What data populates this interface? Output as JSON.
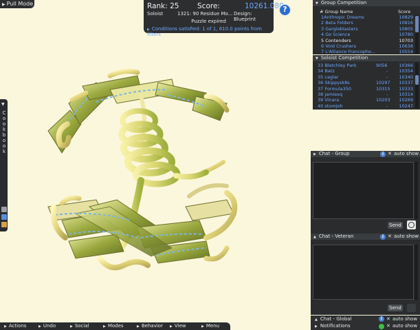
{
  "top_left": {
    "pull_mode_label": "Pull Mode"
  },
  "score_panel": {
    "rank_label": "Rank: 25",
    "score_label": "Score:",
    "score_value": "10261.080",
    "mode": "Soloist",
    "puzzle_desc": "1321: 90 Residue Mo...",
    "design_label": "Design: Blueprint",
    "status": "Puzzle expired",
    "conditions": "Conditions satisfied: 1 of 1, 610.0 points from filters"
  },
  "help_button": {
    "label": "?"
  },
  "group_competition": {
    "title": "Group Competition",
    "col_group": "# Group Name",
    "col_score": "Score",
    "rows": [
      {
        "name": "1Anthropic Dreams",
        "score": "10829",
        "self": false
      },
      {
        "name": "2 Beta Folders",
        "score": "10816",
        "self": false
      },
      {
        "name": "3 Gargleblasters",
        "score": "10805",
        "self": false
      },
      {
        "name": "4 Go Science",
        "score": "10780",
        "self": false
      },
      {
        "name": "5 Contenders",
        "score": "10703",
        "self": true
      },
      {
        "name": "6 Void Crushers",
        "score": "10638",
        "self": false
      },
      {
        "name": "7 L'Alliance Francopho...",
        "score": "10554",
        "self": false
      }
    ]
  },
  "soloist_competition": {
    "title": "Soloist Competition",
    "rows": [
      {
        "name": "33 Bletchley Park",
        "mid": "9056",
        "score": "10366"
      },
      {
        "name": "34 Batz",
        "mid": "-",
        "score": "10354"
      },
      {
        "name": "35 caglar",
        "mid": "-",
        "score": "10340"
      },
      {
        "name": "36 Skippysk8s",
        "mid": "10297",
        "score": "10337"
      },
      {
        "name": "37 Formula350",
        "mid": "10315",
        "score": "10333"
      },
      {
        "name": "38 jamiexq",
        "mid": "-",
        "score": "10314"
      },
      {
        "name": "39 Vinara",
        "mid": "10203",
        "score": "10269"
      },
      {
        "name": "40 stomjoh",
        "mid": "-",
        "score": "10247"
      }
    ]
  },
  "chat_group": {
    "title": "Chat - Group",
    "auto_show": "auto show",
    "send_label": "Send"
  },
  "chat_veteran": {
    "title": "Chat - Veteran",
    "auto_show": "auto show",
    "send_label": "Send"
  },
  "chat_global": {
    "title": "Chat - Global",
    "auto_show": "auto show"
  },
  "notifications": {
    "title": "Notifications",
    "auto_show": "auto show"
  },
  "cookbook": {
    "label": "Cookbook"
  },
  "bottom_menu": [
    {
      "label": "Actions"
    },
    {
      "label": "Undo"
    },
    {
      "label": "Social"
    },
    {
      "label": "Modes"
    },
    {
      "label": "Behavior"
    },
    {
      "label": "View"
    },
    {
      "label": "Menu"
    }
  ],
  "colors": {
    "background": "#fbf7dc",
    "panel": "#2a2c2e",
    "link_blue": "#6fa8ff",
    "helix_yellow": "#e9e08a",
    "sheet_green": "#8a9a3a"
  }
}
